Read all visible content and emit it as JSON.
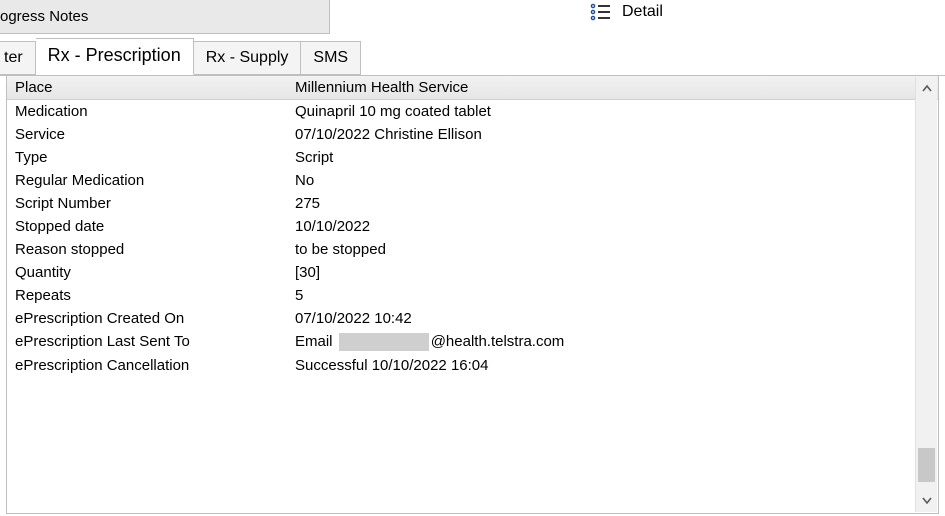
{
  "topbar": {
    "title_fragment": "ogress Notes",
    "detail_label": "Detail"
  },
  "tabs": {
    "partial_first": "ter",
    "items": [
      {
        "label": "Rx - Prescription",
        "active": true
      },
      {
        "label": "Rx - Supply",
        "active": false
      },
      {
        "label": "SMS",
        "active": false
      }
    ]
  },
  "fields": [
    {
      "label": "Place",
      "value": "Millennium Health Service",
      "header": true
    },
    {
      "label": "Medication",
      "value": "Quinapril 10 mg coated tablet"
    },
    {
      "label": "Service",
      "value": "07/10/2022  Christine Ellison"
    },
    {
      "label": "Type",
      "value": "Script"
    },
    {
      "label": "Regular Medication",
      "value": "No"
    },
    {
      "label": "Script Number",
      "value": "275"
    },
    {
      "label": "Stopped date",
      "value": "10/10/2022"
    },
    {
      "label": "Reason stopped",
      "value": "to be stopped"
    },
    {
      "label": "Quantity",
      "value": "[30]"
    },
    {
      "label": "Repeats",
      "value": "5"
    },
    {
      "label": "ePrescription Created On",
      "value": "07/10/2022 10:42"
    },
    {
      "label": "ePrescription Last Sent To",
      "value_prefix": "Email ",
      "redacted": true,
      "value_suffix": "@health.telstra.com"
    },
    {
      "label": "ePrescription Cancellation",
      "value": "Successful 10/10/2022 16:04"
    }
  ]
}
